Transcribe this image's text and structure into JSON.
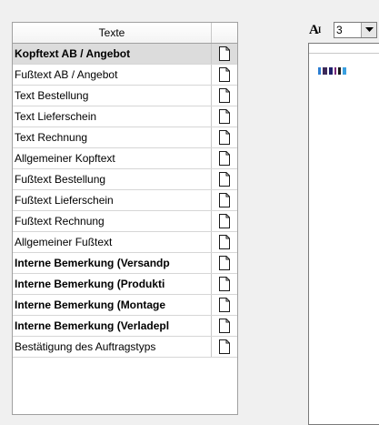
{
  "list": {
    "header": "Texte",
    "items": [
      {
        "label": "Kopftext AB / Angebot",
        "bold": true,
        "selected": true
      },
      {
        "label": "Fußtext AB / Angebot",
        "bold": false,
        "selected": false
      },
      {
        "label": "Text Bestellung",
        "bold": false,
        "selected": false
      },
      {
        "label": "Text Lieferschein",
        "bold": false,
        "selected": false
      },
      {
        "label": "Text Rechnung",
        "bold": false,
        "selected": false
      },
      {
        "label": "Allgemeiner Kopftext",
        "bold": false,
        "selected": false
      },
      {
        "label": "Fußtext Bestellung",
        "bold": false,
        "selected": false
      },
      {
        "label": "Fußtext Lieferschein",
        "bold": false,
        "selected": false
      },
      {
        "label": "Fußtext Rechnung",
        "bold": false,
        "selected": false
      },
      {
        "label": "Allgemeiner Fußtext",
        "bold": false,
        "selected": false
      },
      {
        "label": "Interne Bemerkung (Versandp",
        "bold": true,
        "selected": false
      },
      {
        "label": "Interne Bemerkung (Produkti",
        "bold": true,
        "selected": false
      },
      {
        "label": "Interne Bemerkung (Montage",
        "bold": true,
        "selected": false
      },
      {
        "label": "Interne Bemerkung (Verladepl",
        "bold": true,
        "selected": false
      },
      {
        "label": "Bestätigung des Auftragstyps",
        "bold": false,
        "selected": false
      }
    ]
  },
  "toolbar": {
    "font_size_icon": "A",
    "font_size_value": "3"
  },
  "colors": {
    "selected_row": "#dcdcdc",
    "border": "#a0a0a0",
    "preview": [
      "#2d7fd3",
      "#3d2a5a",
      "#1f1f6b",
      "#7b2a7b",
      "#1a1a1a",
      "#3aa0e0"
    ]
  }
}
